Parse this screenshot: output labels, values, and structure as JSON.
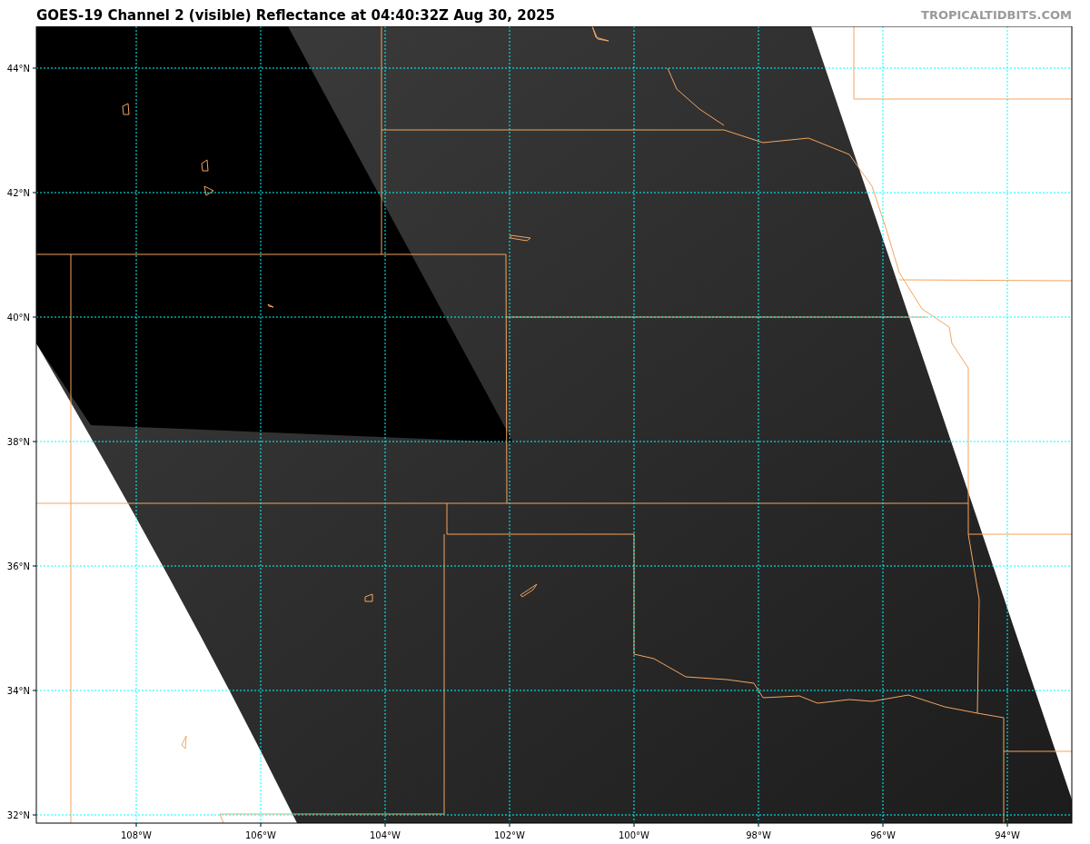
{
  "title": "GOES-19 Channel 2 (visible) Reflectance at 04:40:32Z Aug 30, 2025",
  "credit": "TROPICALTIDBITS.COM",
  "lat_labels": [
    "44°N",
    "42°N",
    "40°N",
    "38°N",
    "36°N",
    "34°N",
    "32°N"
  ],
  "lon_labels": [
    "108°W",
    "106°W",
    "104°W",
    "102°W",
    "100°W",
    "98°W",
    "96°W",
    "94°W"
  ]
}
